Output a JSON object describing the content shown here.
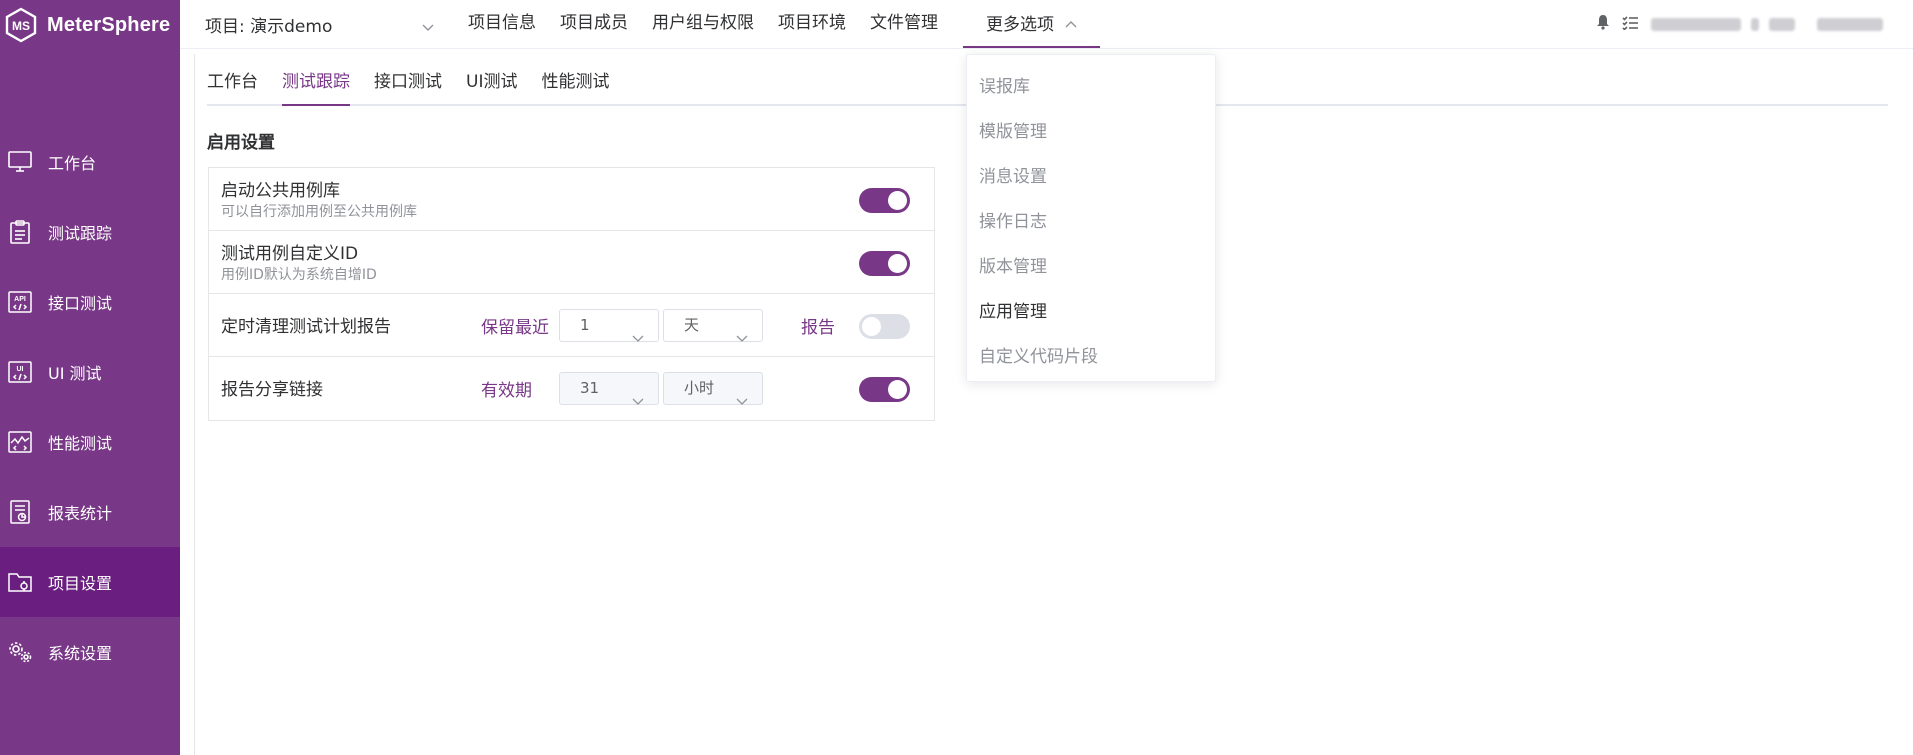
{
  "app": {
    "name": "MeterSphere"
  },
  "sidebar": {
    "items": [
      {
        "label": "工作台",
        "icon": "monitor-icon"
      },
      {
        "label": "测试跟踪",
        "icon": "clipboard-icon"
      },
      {
        "label": "接口测试",
        "icon": "api-icon"
      },
      {
        "label": "UI 测试",
        "icon": "ui-test-icon"
      },
      {
        "label": "性能测试",
        "icon": "performance-icon"
      },
      {
        "label": "报表统计",
        "icon": "report-icon"
      },
      {
        "label": "项目设置",
        "icon": "folder-settings-icon",
        "active": true
      },
      {
        "label": "系统设置",
        "icon": "gears-icon"
      }
    ]
  },
  "header": {
    "project_label": "项目: 演示demo",
    "menu": [
      "项目信息",
      "项目成员",
      "用户组与权限",
      "项目环境",
      "文件管理"
    ],
    "more_label": "更多选项",
    "more_items": [
      "误报库",
      "模版管理",
      "消息设置",
      "操作日志",
      "版本管理",
      "应用管理",
      "自定义代码片段"
    ],
    "more_active_index": 5
  },
  "tabs": {
    "items": [
      "工作台",
      "测试跟踪",
      "接口测试",
      "UI测试",
      "性能测试"
    ],
    "active_index": 1
  },
  "settings": {
    "section_title": "启用设置",
    "public_case": {
      "title": "启动公共用例库",
      "desc": "可以自行添加用例至公共用例库",
      "enabled": true
    },
    "custom_id": {
      "title": "测试用例自定义ID",
      "desc": "用例ID默认为系统自增ID",
      "enabled": true
    },
    "cleanup": {
      "title": "定时清理测试计划报告",
      "keep_label": "保留最近",
      "count": "1",
      "unit": "天",
      "report_label": "报告",
      "enabled": false
    },
    "share": {
      "title": "报告分享链接",
      "validity_label": "有效期",
      "count": "31",
      "unit": "小时",
      "enabled": true
    }
  },
  "colors": {
    "brand": "#783887",
    "sidebar_active": "#6a1f80",
    "muted_text": "#909399",
    "border": "#e6e6e6"
  }
}
